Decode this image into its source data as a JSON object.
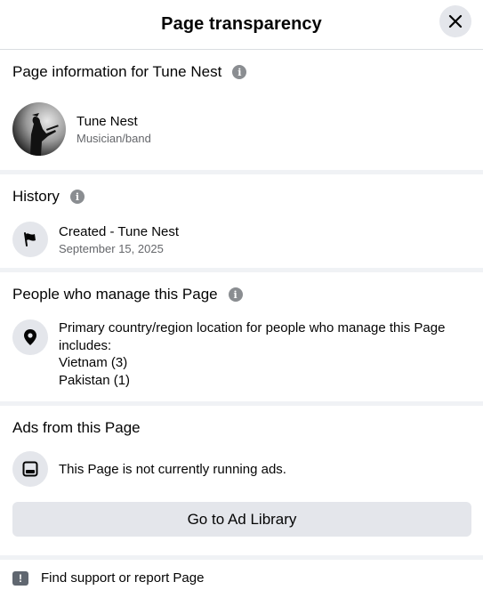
{
  "header": {
    "title": "Page transparency"
  },
  "page_info": {
    "title": "Page information for Tune Nest",
    "name": "Tune Nest",
    "category": "Musician/band"
  },
  "history": {
    "title": "History",
    "entry_title": "Created - Tune Nest",
    "entry_date": "September 15, 2025"
  },
  "managers": {
    "title": "People who manage this Page",
    "description": "Primary country/region location for people who manage this Page includes:",
    "locations": [
      "Vietnam (3)",
      "Pakistan (1)"
    ]
  },
  "ads": {
    "title": "Ads from this Page",
    "status": "This Page is not currently running ads.",
    "button_label": "Go to Ad Library"
  },
  "footer": {
    "report_label": "Find support or report Page"
  },
  "icons": {
    "close": "close-icon",
    "info": "info-icon",
    "flag": "flag-icon",
    "location": "location-pin-icon",
    "ads": "ad-library-icon",
    "report": "report-icon"
  }
}
